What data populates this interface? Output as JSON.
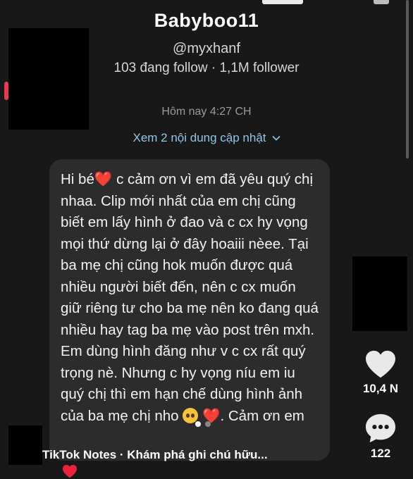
{
  "profile": {
    "name": "Babyboo11",
    "handle": "@myxhanf",
    "stats": "103 đang follow · 1,1M follower"
  },
  "conversation": {
    "timestamp": "Hôm nay 4:27 CH",
    "updates_label": "Xem 2 nội dung cập nhật"
  },
  "note": {
    "text_1": "Hi bé",
    "text_2": " c cảm ơn vì em đã yêu quý chị nhaa. Clip mới nhất của em chị cũng biết em lấy hình ở đao và c cx hy vọng mọi thứ dừng lại ở đây hoaiii nèee. Tại ba mẹ chị cũng hok muốn được quá nhiều người biết đến, nên c cx muốn giữ riêng tư cho ba mẹ nên ko đang quá nhiều hay tag ba mẹ vào post trên mxh. Em dùng hình đăng như v c cx rất quý trọng nè. Nhưng c hy vọng níu em iu quý chị thì em hạn chế dùng hình ảnh của ba mẹ chị nho ",
    "text_3": ". Cảm ơn em",
    "heart_glyph": "❤️"
  },
  "actions": {
    "like_count": "10,4 N",
    "comment_count": "122"
  },
  "footer": {
    "notes_label": "TikTok Notes · Khám phá ghi chú hữu..."
  },
  "colors": {
    "background": "#181818",
    "bubble": "#2c2c2c",
    "link": "#8fc7e8",
    "heart": "#e8233d"
  },
  "icons": [
    "heart-icon",
    "comment-icon",
    "chevron-down-icon",
    "pleading-face-icon"
  ]
}
